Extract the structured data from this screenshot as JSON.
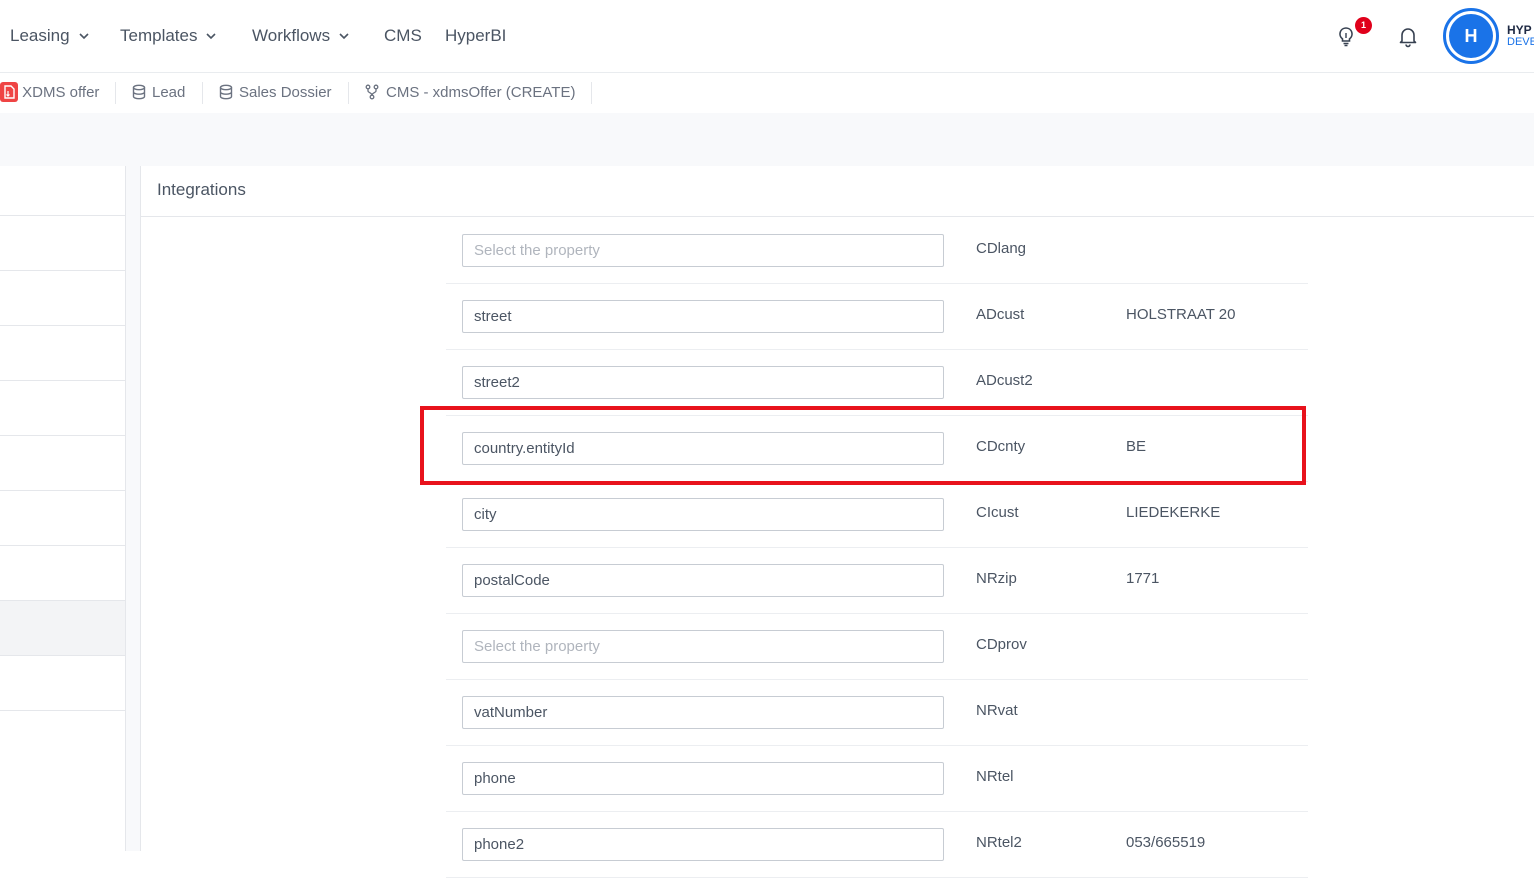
{
  "nav": {
    "items": [
      {
        "label": "Leasing",
        "dropdown": true
      },
      {
        "label": "Templates",
        "dropdown": true
      },
      {
        "label": "Workflows",
        "dropdown": true
      },
      {
        "label": "CMS",
        "dropdown": false
      },
      {
        "label": "HyperBI",
        "dropdown": false
      }
    ],
    "notification_count": "1",
    "user": {
      "initial": "H",
      "name": "HYP",
      "role": "DEVE"
    }
  },
  "tabs": [
    {
      "label": "XDMS offer",
      "icon": "document-icon"
    },
    {
      "label": "Lead",
      "icon": "database-icon"
    },
    {
      "label": "Sales Dossier",
      "icon": "database-icon"
    },
    {
      "label": "CMS - xdmsOffer (CREATE)",
      "icon": "fork-icon"
    }
  ],
  "panel": {
    "title": "Integrations",
    "placeholder": "Select the property",
    "rows": [
      {
        "property": "",
        "code": "CDlang",
        "value": ""
      },
      {
        "property": "street",
        "code": "ADcust",
        "value": "HOLSTRAAT 20"
      },
      {
        "property": "street2",
        "code": "ADcust2",
        "value": ""
      },
      {
        "property": "country.entityId",
        "code": "CDcnty",
        "value": "BE"
      },
      {
        "property": "city",
        "code": "CIcust",
        "value": "LIEDEKERKE"
      },
      {
        "property": "postalCode",
        "code": "NRzip",
        "value": "1771"
      },
      {
        "property": "",
        "code": "CDprov",
        "value": ""
      },
      {
        "property": "vatNumber",
        "code": "NRvat",
        "value": ""
      },
      {
        "property": "phone",
        "code": "NRtel",
        "value": ""
      },
      {
        "property": "phone2",
        "code": "NRtel2",
        "value": "053/665519"
      }
    ]
  },
  "colors": {
    "accent": "#1a73e8",
    "highlight": "#e8121c",
    "badge": "#e0001b"
  }
}
